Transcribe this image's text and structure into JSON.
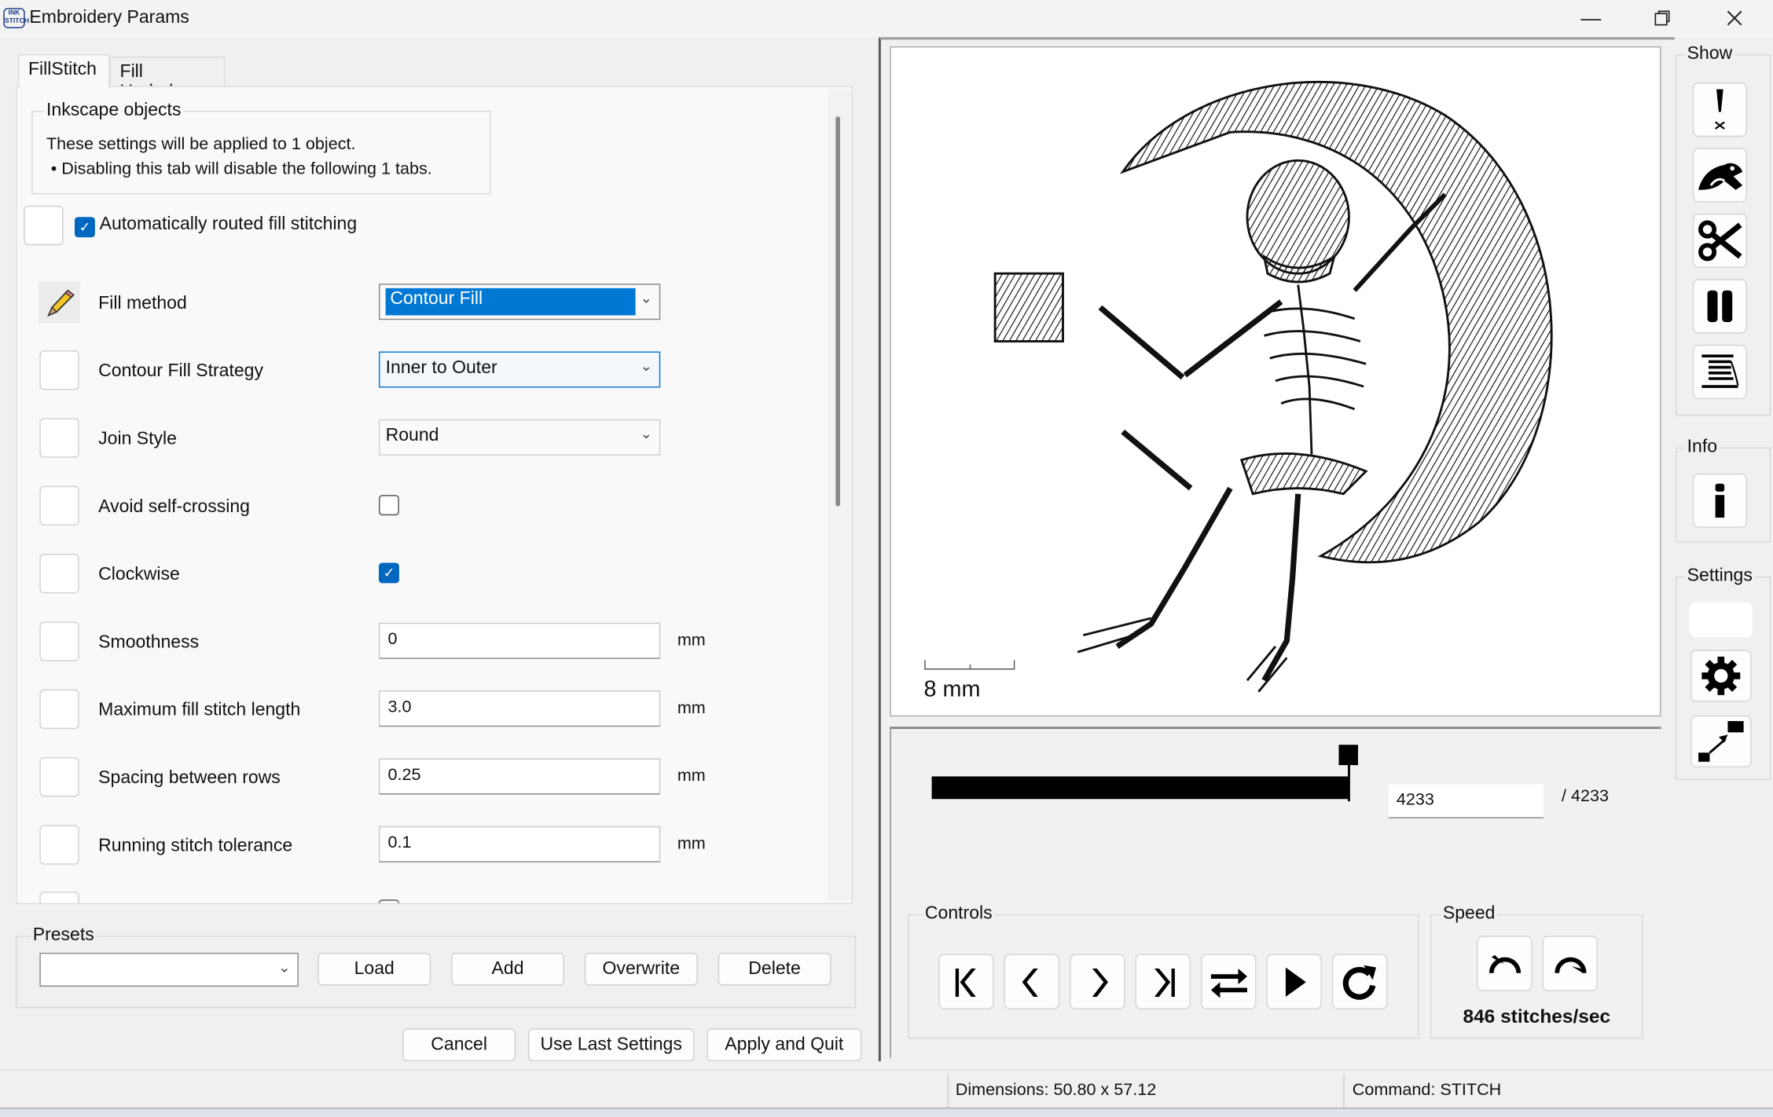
{
  "window": {
    "title": "Embroidery Params",
    "app_icon_text": "INK STITCH",
    "controls": [
      "minimize",
      "restore",
      "close"
    ]
  },
  "tabs": [
    {
      "label": "FillStitch",
      "selected": true
    },
    {
      "label": "Fill Underlay",
      "selected": false
    }
  ],
  "info_group": {
    "label": "Inkscape objects",
    "line1": "These settings will be applied to 1 object.",
    "line2": "• Disabling this tab will disable the following 1 tabs."
  },
  "auto_route": {
    "label": "Automatically routed fill stitching",
    "checked": true
  },
  "params": [
    {
      "label": "Fill method",
      "type": "select",
      "value": "Contour Fill",
      "icon": "pencil-icon"
    },
    {
      "label": "Contour Fill Strategy",
      "type": "select",
      "value": "Inner to Outer"
    },
    {
      "label": "Join Style",
      "type": "select",
      "value": "Round"
    },
    {
      "label": "Avoid self-crossing",
      "type": "checkbox",
      "checked": false
    },
    {
      "label": "Clockwise",
      "type": "checkbox",
      "checked": true
    },
    {
      "label": "Smoothness",
      "type": "number",
      "value": "0",
      "unit": "mm"
    },
    {
      "label": "Maximum fill stitch length",
      "type": "number",
      "value": "3.0",
      "unit": "mm"
    },
    {
      "label": "Spacing between rows",
      "type": "number",
      "value": "0.25",
      "unit": "mm"
    },
    {
      "label": "Running stitch tolerance",
      "type": "number",
      "value": "0.1",
      "unit": "mm"
    }
  ],
  "presets": {
    "label": "Presets",
    "value": "",
    "buttons": [
      "Load",
      "Add",
      "Overwrite",
      "Delete"
    ]
  },
  "actions": [
    "Cancel",
    "Use Last Settings",
    "Apply and Quit"
  ],
  "preview": {
    "scale_label": "8 mm"
  },
  "slider": {
    "current": "4233",
    "total": "/ 4233",
    "progress": 1.0
  },
  "controls": {
    "label": "Controls",
    "buttons": [
      "skip-to-start-icon",
      "step-back-icon",
      "step-forward-icon",
      "skip-to-end-icon",
      "swap-direction-icon",
      "play-icon",
      "restart-icon"
    ]
  },
  "speed": {
    "label": "Speed",
    "text": "846 stitches/sec",
    "buttons": [
      "slower-icon",
      "faster-icon"
    ]
  },
  "sidebar": {
    "show_label": "Show",
    "info_label": "Info",
    "settings_label": "Settings"
  },
  "status": {
    "dimensions": "Dimensions: 50.80 x 57.12",
    "command": "Command: STITCH"
  }
}
